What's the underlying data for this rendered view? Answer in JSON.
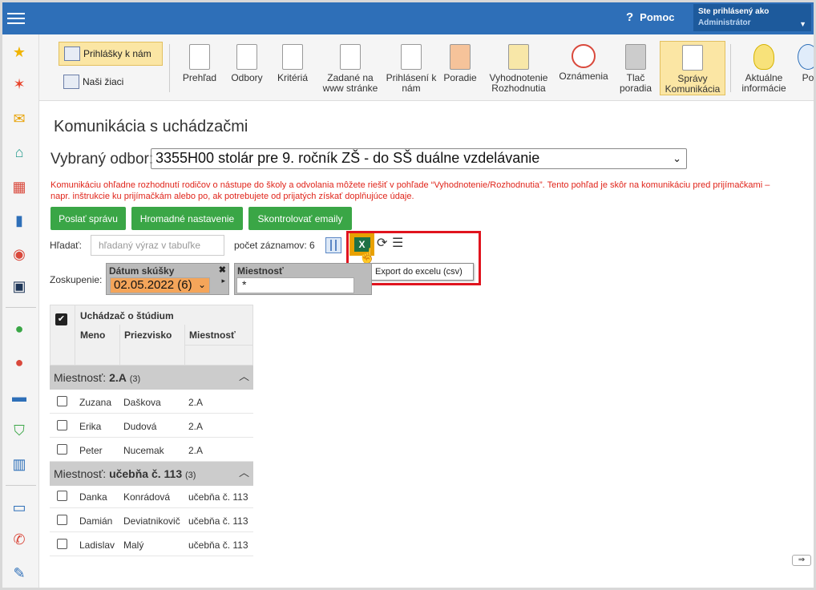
{
  "topbar": {
    "help_label": "Pomoc",
    "user_line1": "Ste prihlásený ako",
    "user_line2": "Administrátor"
  },
  "ribbon": {
    "small": [
      {
        "label": "Prihlášky k nám"
      },
      {
        "label": "Naši žiaci"
      }
    ],
    "items": [
      {
        "label": "Prehľad"
      },
      {
        "label": "Odbory"
      },
      {
        "label": "Kritériá"
      },
      {
        "label": "Zadané na www stránke"
      },
      {
        "label": "Prihlásení k nám"
      },
      {
        "label": "Poradie"
      },
      {
        "label": "Vyhodnotenie Rozhodnutia"
      },
      {
        "label": "Oznámenia"
      },
      {
        "label": "Tlač poradia"
      },
      {
        "label": "Správy Komunikácia"
      },
      {
        "label": "Aktuálne informácie"
      },
      {
        "label": "Po"
      }
    ]
  },
  "page": {
    "title": "Komunikácia s uchádzačmi",
    "field_label": "Vybraný odbor:",
    "field_value": "3355H00 stolár pre 9. ročník ZŠ - do SŠ duálne vzdelávanie",
    "note": "Komunikáciu ohľadne rozhodnutí rodičov o nástupe do školy a odvolania môžete riešiť v pohľade “Vyhodnotenie/Rozhodnutia”. Tento pohľad je skôr na komunikáciu pred prijímačkami – napr. inštrukcie ku prijímačkám alebo po, ak potrebujete od prijatých získať doplňujúce údaje.",
    "buttons": {
      "send": "Poslať správu",
      "bulk": "Hromadné nastavenie",
      "check": "Skontrolovať emaily"
    },
    "search_label": "Hľadať:",
    "search_placeholder": "hľadaný výraz v tabuľke",
    "count_label": "počet záznamov: 6",
    "tooltip": "Export do excelu (csv)",
    "group_label": "Zoskupenie:",
    "chip1": {
      "header": "Dátum skúšky",
      "value": "02.05.2022 (6)"
    },
    "chip2": {
      "header": "Miestnosť",
      "value": "*"
    }
  },
  "grid": {
    "group_title": "Uchádzač o štúdium",
    "cols": [
      "Meno",
      "Priezvisko",
      "Miestnosť"
    ],
    "groups": [
      {
        "prefix": "Miestnosť:",
        "name": "2.A",
        "count": "(3)",
        "rows": [
          [
            "Zuzana",
            "Daškova",
            "2.A"
          ],
          [
            "Erika",
            "Dudová",
            "2.A"
          ],
          [
            "Peter",
            "Nucemak",
            "2.A"
          ]
        ]
      },
      {
        "prefix": "Miestnosť:",
        "name": "učebňa č. 113",
        "count": "(3)",
        "rows": [
          [
            "Danka",
            "Konrádová",
            "učebňa č. 113"
          ],
          [
            "Damián",
            "Deviatnikovič",
            "učebňa č. 113"
          ],
          [
            "Ladislav",
            "Malý",
            "učebňa č. 113"
          ]
        ]
      }
    ]
  }
}
